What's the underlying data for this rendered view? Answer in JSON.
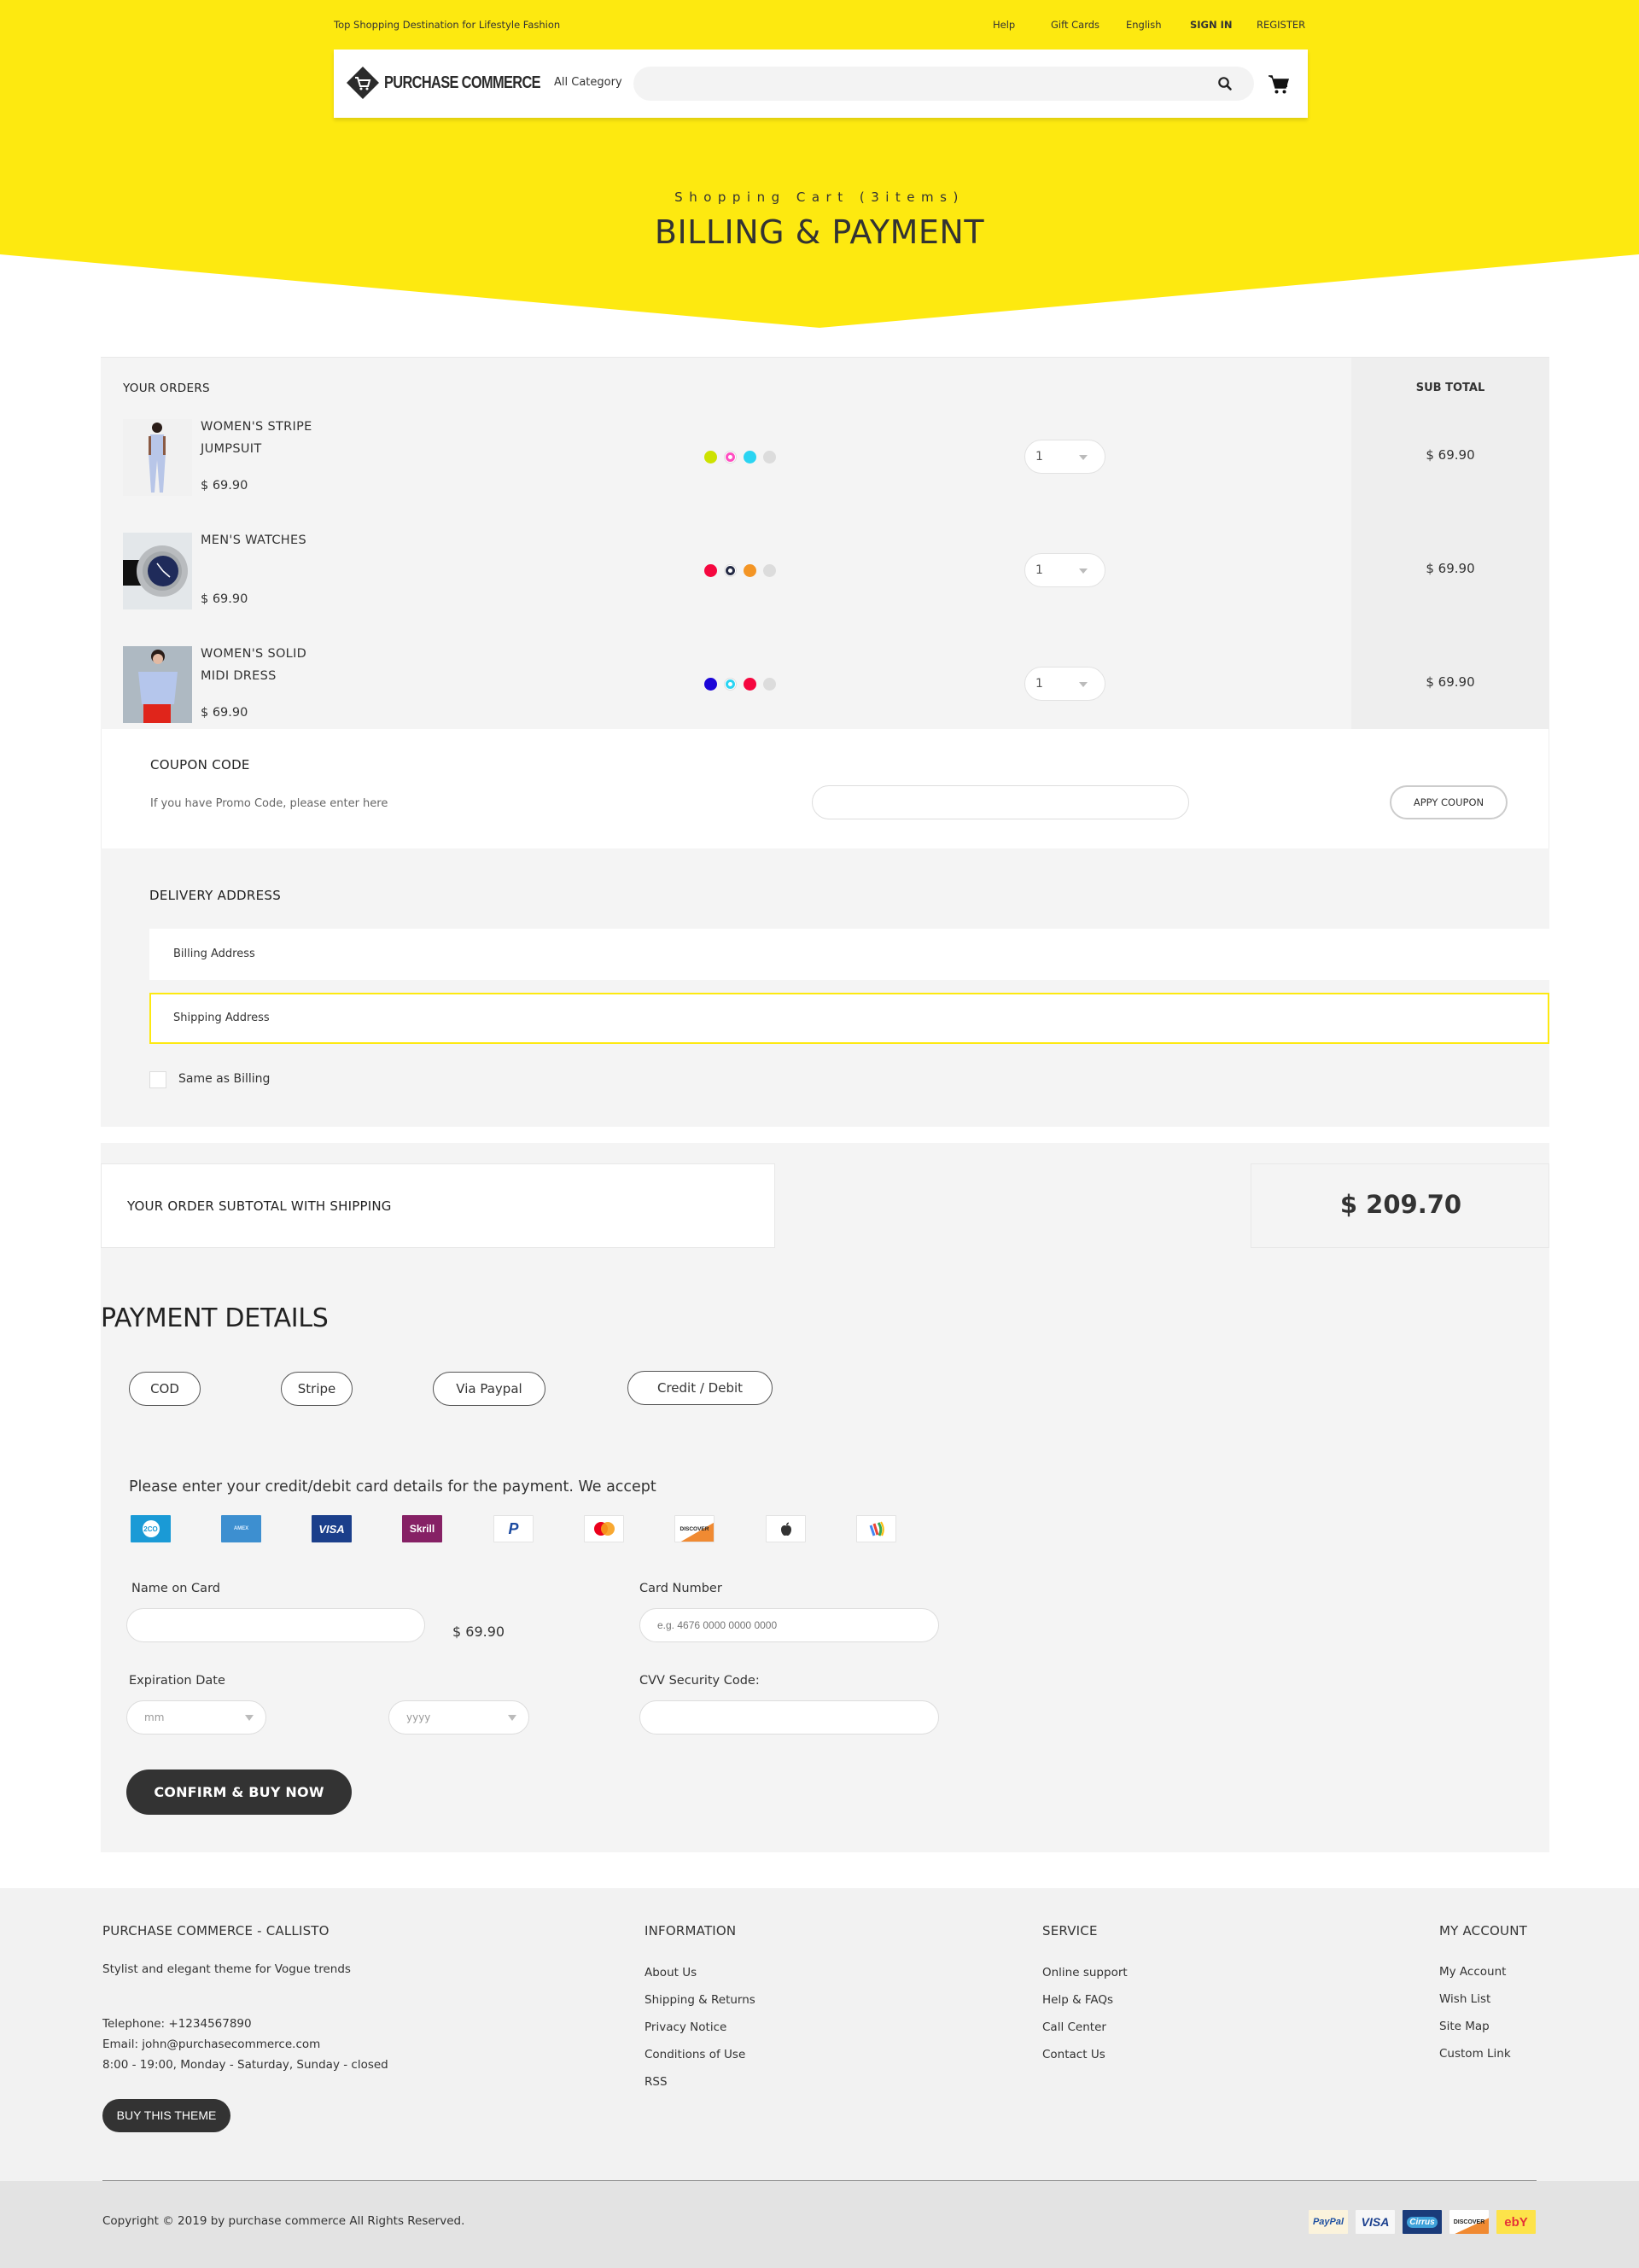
{
  "colors": {
    "brand_yellow": "#fde910",
    "dark": "#333333",
    "panel_bg": "#f4f4f4"
  },
  "topbar": {
    "tagline": "Top Shopping Destination for Lifestyle Fashion",
    "links": [
      {
        "label": "Help"
      },
      {
        "label": "Gift Cards"
      },
      {
        "label": "English"
      },
      {
        "label": "SIGN IN"
      },
      {
        "label": "REGISTER"
      }
    ]
  },
  "header": {
    "logo_text": "PURCHASE COMMERCE",
    "logo_icon": "cart-diamond-icon",
    "category_label": "All Category",
    "search_placeholder": "",
    "search_icon": "search-icon",
    "cart_icon": "shopping-cart-icon"
  },
  "hero": {
    "subtitle": "Shopping Cart (3items)",
    "title": "BILLING & PAYMENT"
  },
  "orders": {
    "heading": "YOUR ORDERS",
    "subtotal_heading": "SUB TOTAL",
    "items": [
      {
        "name_line1": "WOMEN'S STRIPE",
        "name_line2": "JUMPSUIT",
        "price": "$ 69.90",
        "swatches": [
          "#cde200",
          "#ff4fc1",
          "#2ad4f2",
          "#dcdcdc"
        ],
        "selected_swatch": 1,
        "quantity": "1",
        "subtotal": "$ 69.90"
      },
      {
        "name_line1": "MEN'S WATCHES",
        "name_line2": "",
        "price": "$ 69.90",
        "swatches": [
          "#f5073f",
          "#252b45",
          "#f39525",
          "#dcdcdc"
        ],
        "selected_swatch": 1,
        "quantity": "1",
        "subtotal": "$ 69.90"
      },
      {
        "name_line1": "WOMEN'S SOLID",
        "name_line2": "MIDI DRESS",
        "price": "$ 69.90",
        "swatches": [
          "#1b05d8",
          "#2ad4f2",
          "#f5073f",
          "#dcdcdc"
        ],
        "selected_swatch": 1,
        "quantity": "1",
        "subtotal": "$ 69.90"
      }
    ]
  },
  "coupon": {
    "title": "COUPON CODE",
    "hint": "If you have Promo Code, please enter here",
    "input_value": "",
    "button_label": "APPY COUPON"
  },
  "delivery": {
    "title": "DELIVERY ADDRESS",
    "billing_placeholder": "Billing Address",
    "shipping_placeholder": "Shipping Address",
    "same_as_billing_label": "Same as Billing",
    "same_as_billing_checked": false
  },
  "summary": {
    "label": "YOUR ORDER SUBTOTAL WITH SHIPPING",
    "total": "$ 209.70"
  },
  "payment": {
    "title": "PAYMENT DETAILS",
    "methods": [
      {
        "label": "COD"
      },
      {
        "label": "Stripe"
      },
      {
        "label": "Via Paypal"
      },
      {
        "label": "Credit / Debit"
      }
    ],
    "accept_message": "Please enter your credit/debit card details for the payment. We accept",
    "accepted_cards": [
      {
        "name": "2co",
        "text": "2CO"
      },
      {
        "name": "american-express",
        "text": "AMEX"
      },
      {
        "name": "visa",
        "text": "VISA"
      },
      {
        "name": "skrill",
        "text": "Skrill"
      },
      {
        "name": "paypal",
        "text": "P"
      },
      {
        "name": "mastercard",
        "text": ""
      },
      {
        "name": "discover",
        "text": "DISCOVER"
      },
      {
        "name": "apple-pay",
        "text": ""
      },
      {
        "name": "google-wallet",
        "text": ""
      }
    ],
    "name_on_card_label": "Name on Card",
    "name_on_card_value": "",
    "name_price": "$ 69.90",
    "card_number_label": "Card Number",
    "card_number_placeholder": "e.g. 4676 0000 0000 0000",
    "expiration_label": "Expiration Date",
    "month_placeholder": "mm",
    "year_placeholder": "yyyy",
    "cvv_label": "CVV Security Code:",
    "cvv_value": "",
    "confirm_label": "CONFIRM & BUY NOW"
  },
  "footer": {
    "brand_heading": "PURCHASE COMMERCE - CALLISTO",
    "tagline": "Stylist and elegant theme for Vogue trends",
    "telephone": "Telephone: +1234567890",
    "email": "Email: john@purchasecommerce.com",
    "hours": "8:00 - 19:00, Monday - Saturday, Sunday - closed",
    "buy_theme_label": "BUY THIS THEME",
    "columns": [
      {
        "heading": "INFORMATION",
        "links": [
          "About Us",
          "Shipping & Returns",
          "Privacy Notice",
          "Conditions of Use",
          "RSS"
        ]
      },
      {
        "heading": "SERVICE",
        "links": [
          "Online support",
          "Help & FAQs",
          "Call Center",
          "Contact Us"
        ]
      },
      {
        "heading": "MY ACCOUNT",
        "links": [
          "My Account",
          "Wish List",
          "Site Map",
          "Custom Link"
        ]
      }
    ],
    "copyright": "Copyright © 2019 by purchase commerce All Rights Reserved.",
    "payment_logos": [
      {
        "name": "paypal",
        "text": "PayPal"
      },
      {
        "name": "visa",
        "text": "VISA"
      },
      {
        "name": "cirrus",
        "text": "Cirrus"
      },
      {
        "name": "discover",
        "text": "DISCOVER"
      },
      {
        "name": "ebay",
        "text": "ebY"
      }
    ]
  }
}
